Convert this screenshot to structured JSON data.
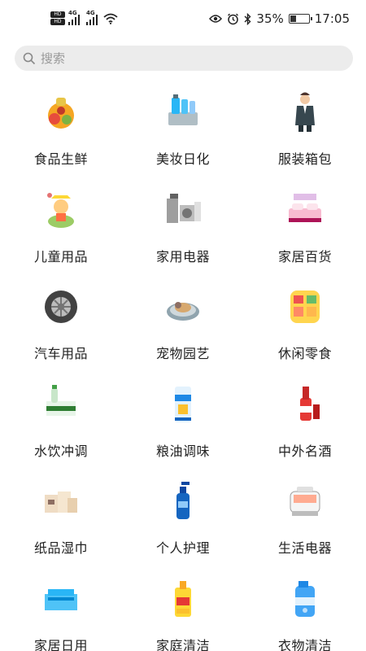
{
  "status_bar": {
    "hd1": "HD",
    "hd2": "HD",
    "net1": "4G",
    "net2": "4G",
    "battery_percent": "35%",
    "battery_level": 0.35,
    "time": "17:05",
    "icons": [
      "eye-icon",
      "alarm-icon",
      "bluetooth-icon",
      "battery-icon",
      "wifi-icon"
    ]
  },
  "search": {
    "placeholder": "搜索",
    "value": ""
  },
  "categories": [
    {
      "label": "食品生鲜",
      "icon": "food-fresh-icon"
    },
    {
      "label": "美妆日化",
      "icon": "cosmetics-icon"
    },
    {
      "label": "服装箱包",
      "icon": "clothing-icon"
    },
    {
      "label": "儿童用品",
      "icon": "kids-icon"
    },
    {
      "label": "家用电器",
      "icon": "home-appliance-icon"
    },
    {
      "label": "家居百货",
      "icon": "home-goods-icon"
    },
    {
      "label": "汽车用品",
      "icon": "car-tire-icon"
    },
    {
      "label": "宠物园艺",
      "icon": "pet-garden-icon"
    },
    {
      "label": "休闲零食",
      "icon": "snacks-icon"
    },
    {
      "label": "水饮冲调",
      "icon": "drinks-icon"
    },
    {
      "label": "粮油调味",
      "icon": "grain-oil-icon"
    },
    {
      "label": "中外名酒",
      "icon": "liquor-icon"
    },
    {
      "label": "纸品湿巾",
      "icon": "paper-tissue-icon"
    },
    {
      "label": "个人护理",
      "icon": "personal-care-icon"
    },
    {
      "label": "生活电器",
      "icon": "small-appliance-icon"
    },
    {
      "label": "家居日用",
      "icon": "household-storage-icon"
    },
    {
      "label": "家庭清洁",
      "icon": "cleaning-icon"
    },
    {
      "label": "衣物清洁",
      "icon": "laundry-icon"
    }
  ]
}
